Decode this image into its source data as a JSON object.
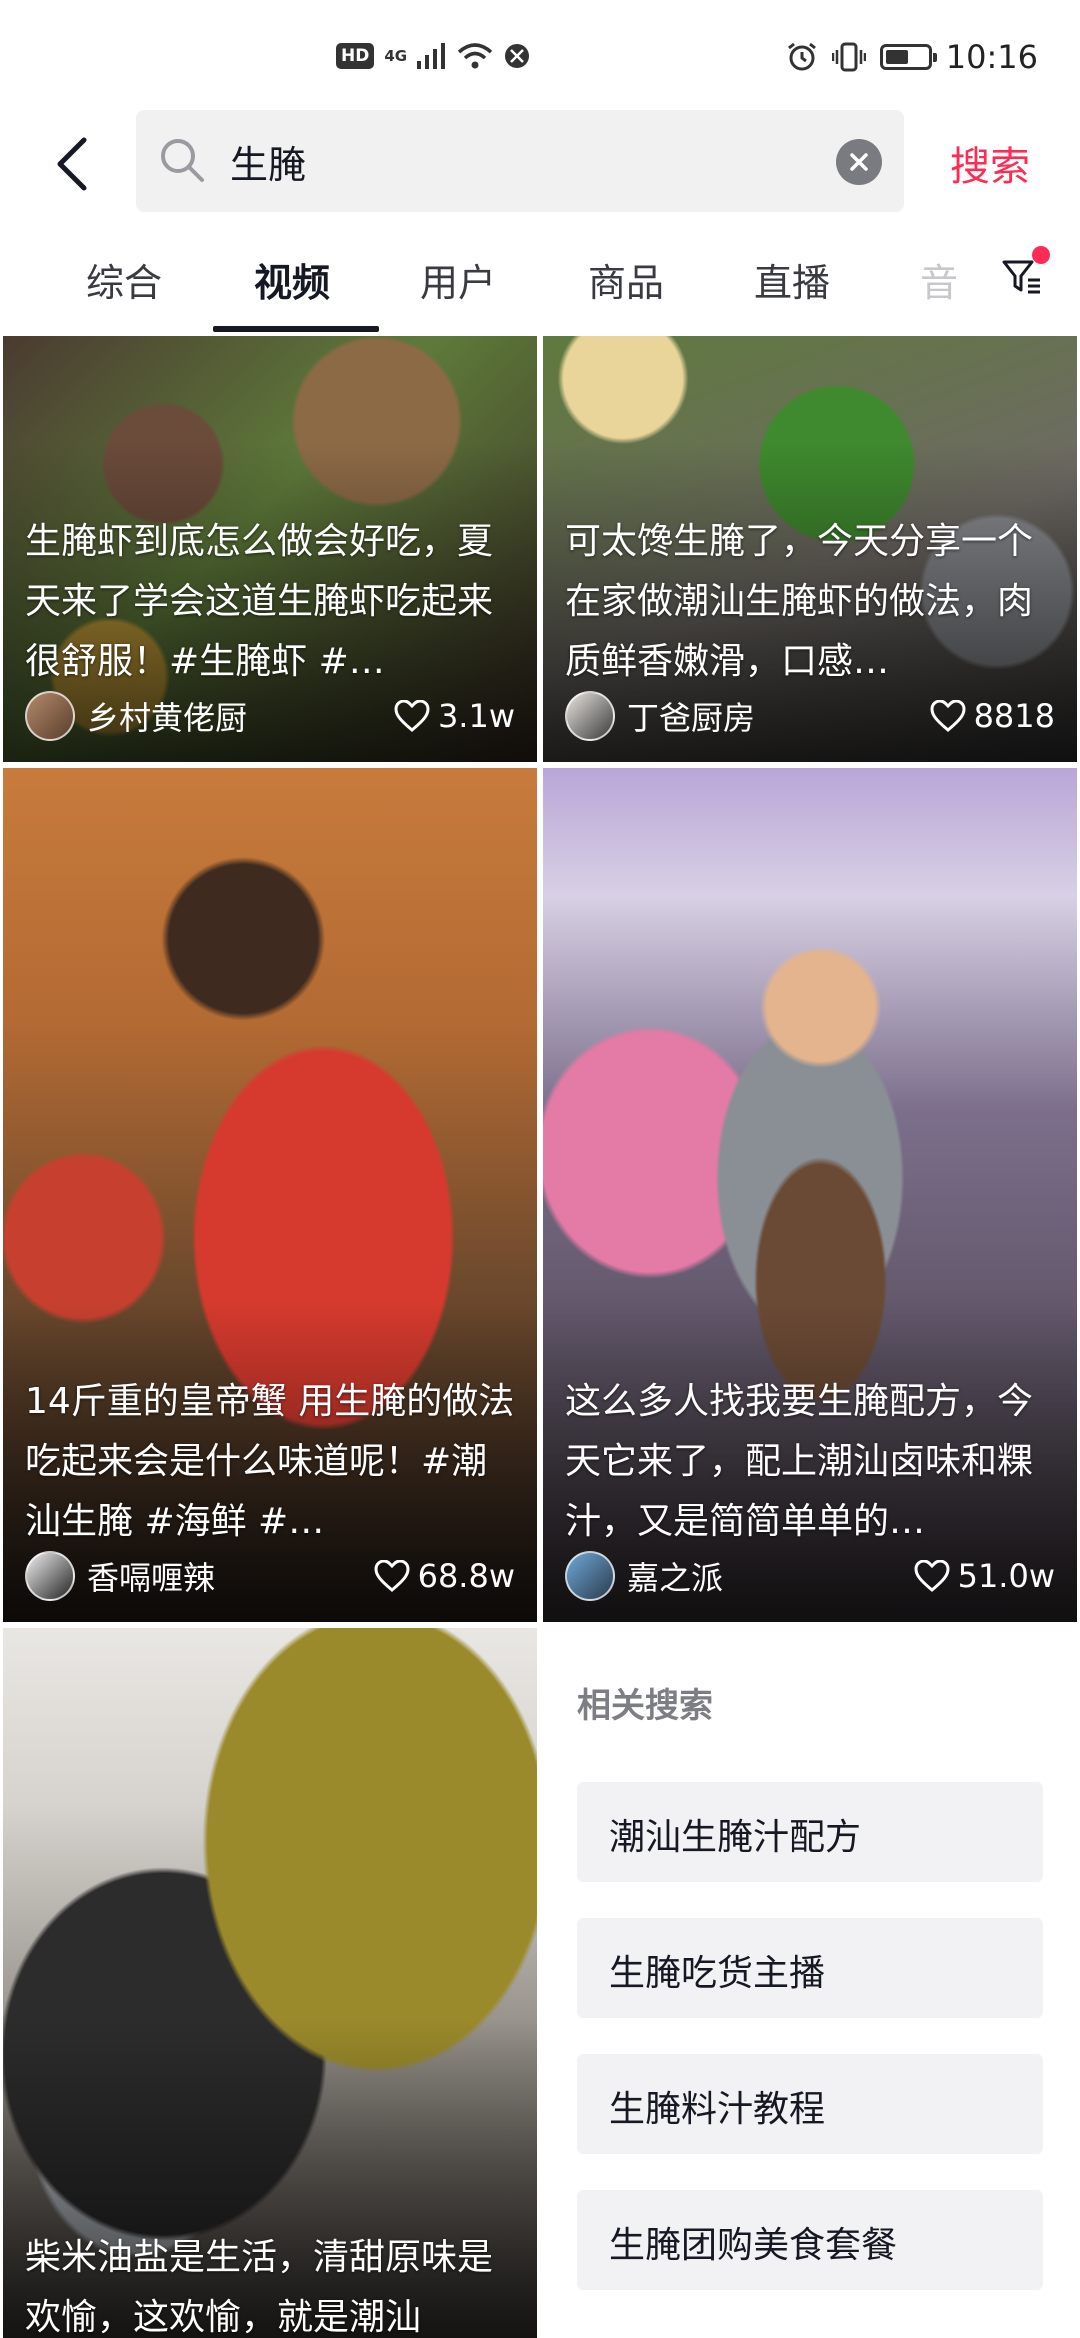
{
  "status_bar": {
    "hd": "HD",
    "network": "4G",
    "time": "10:16",
    "battery_level": 0.55
  },
  "search": {
    "query": "生腌",
    "action_label": "搜索"
  },
  "tabs": [
    {
      "label": "综合",
      "active": false
    },
    {
      "label": "视频",
      "active": true
    },
    {
      "label": "用户",
      "active": false
    },
    {
      "label": "商品",
      "active": false
    },
    {
      "label": "直播",
      "active": false
    },
    {
      "label": "音",
      "active": false
    }
  ],
  "videos": [
    {
      "caption": "生腌虾到底怎么做会好吃，夏天来了学会这道生腌虾吃起来很舒服！#生腌虾 #…",
      "author": "乡村黄佬厨",
      "likes": "3.1w"
    },
    {
      "caption": "可太馋生腌了，今天分享一个在家做潮汕生腌虾的做法，肉质鲜香嫩滑，口感…",
      "author": "丁爸厨房",
      "likes": "8818"
    },
    {
      "caption": "14斤重的皇帝蟹 用生腌的做法 吃起来会是什么味道呢！#潮汕生腌 #海鲜 #…",
      "author": "香嗝喱辣",
      "likes": "68.8w"
    },
    {
      "caption": "这么多人找我要生腌配方，今天它来了，配上潮汕卤味和粿汁，又是简简单单的…",
      "author": "嘉之派",
      "likes": "51.0w"
    },
    {
      "caption": "柴米油盐是生活，清甜原味是欢愉，这欢愉，就是潮汕"
    }
  ],
  "related": {
    "title": "相关搜索",
    "items": [
      "潮汕生腌汁配方",
      "生腌吃货主播",
      "生腌料汁教程",
      "生腌团购美食套餐"
    ]
  },
  "colors": {
    "accent": "#fe2c55",
    "text_primary": "#161823",
    "search_bg": "#f1f1f2"
  }
}
